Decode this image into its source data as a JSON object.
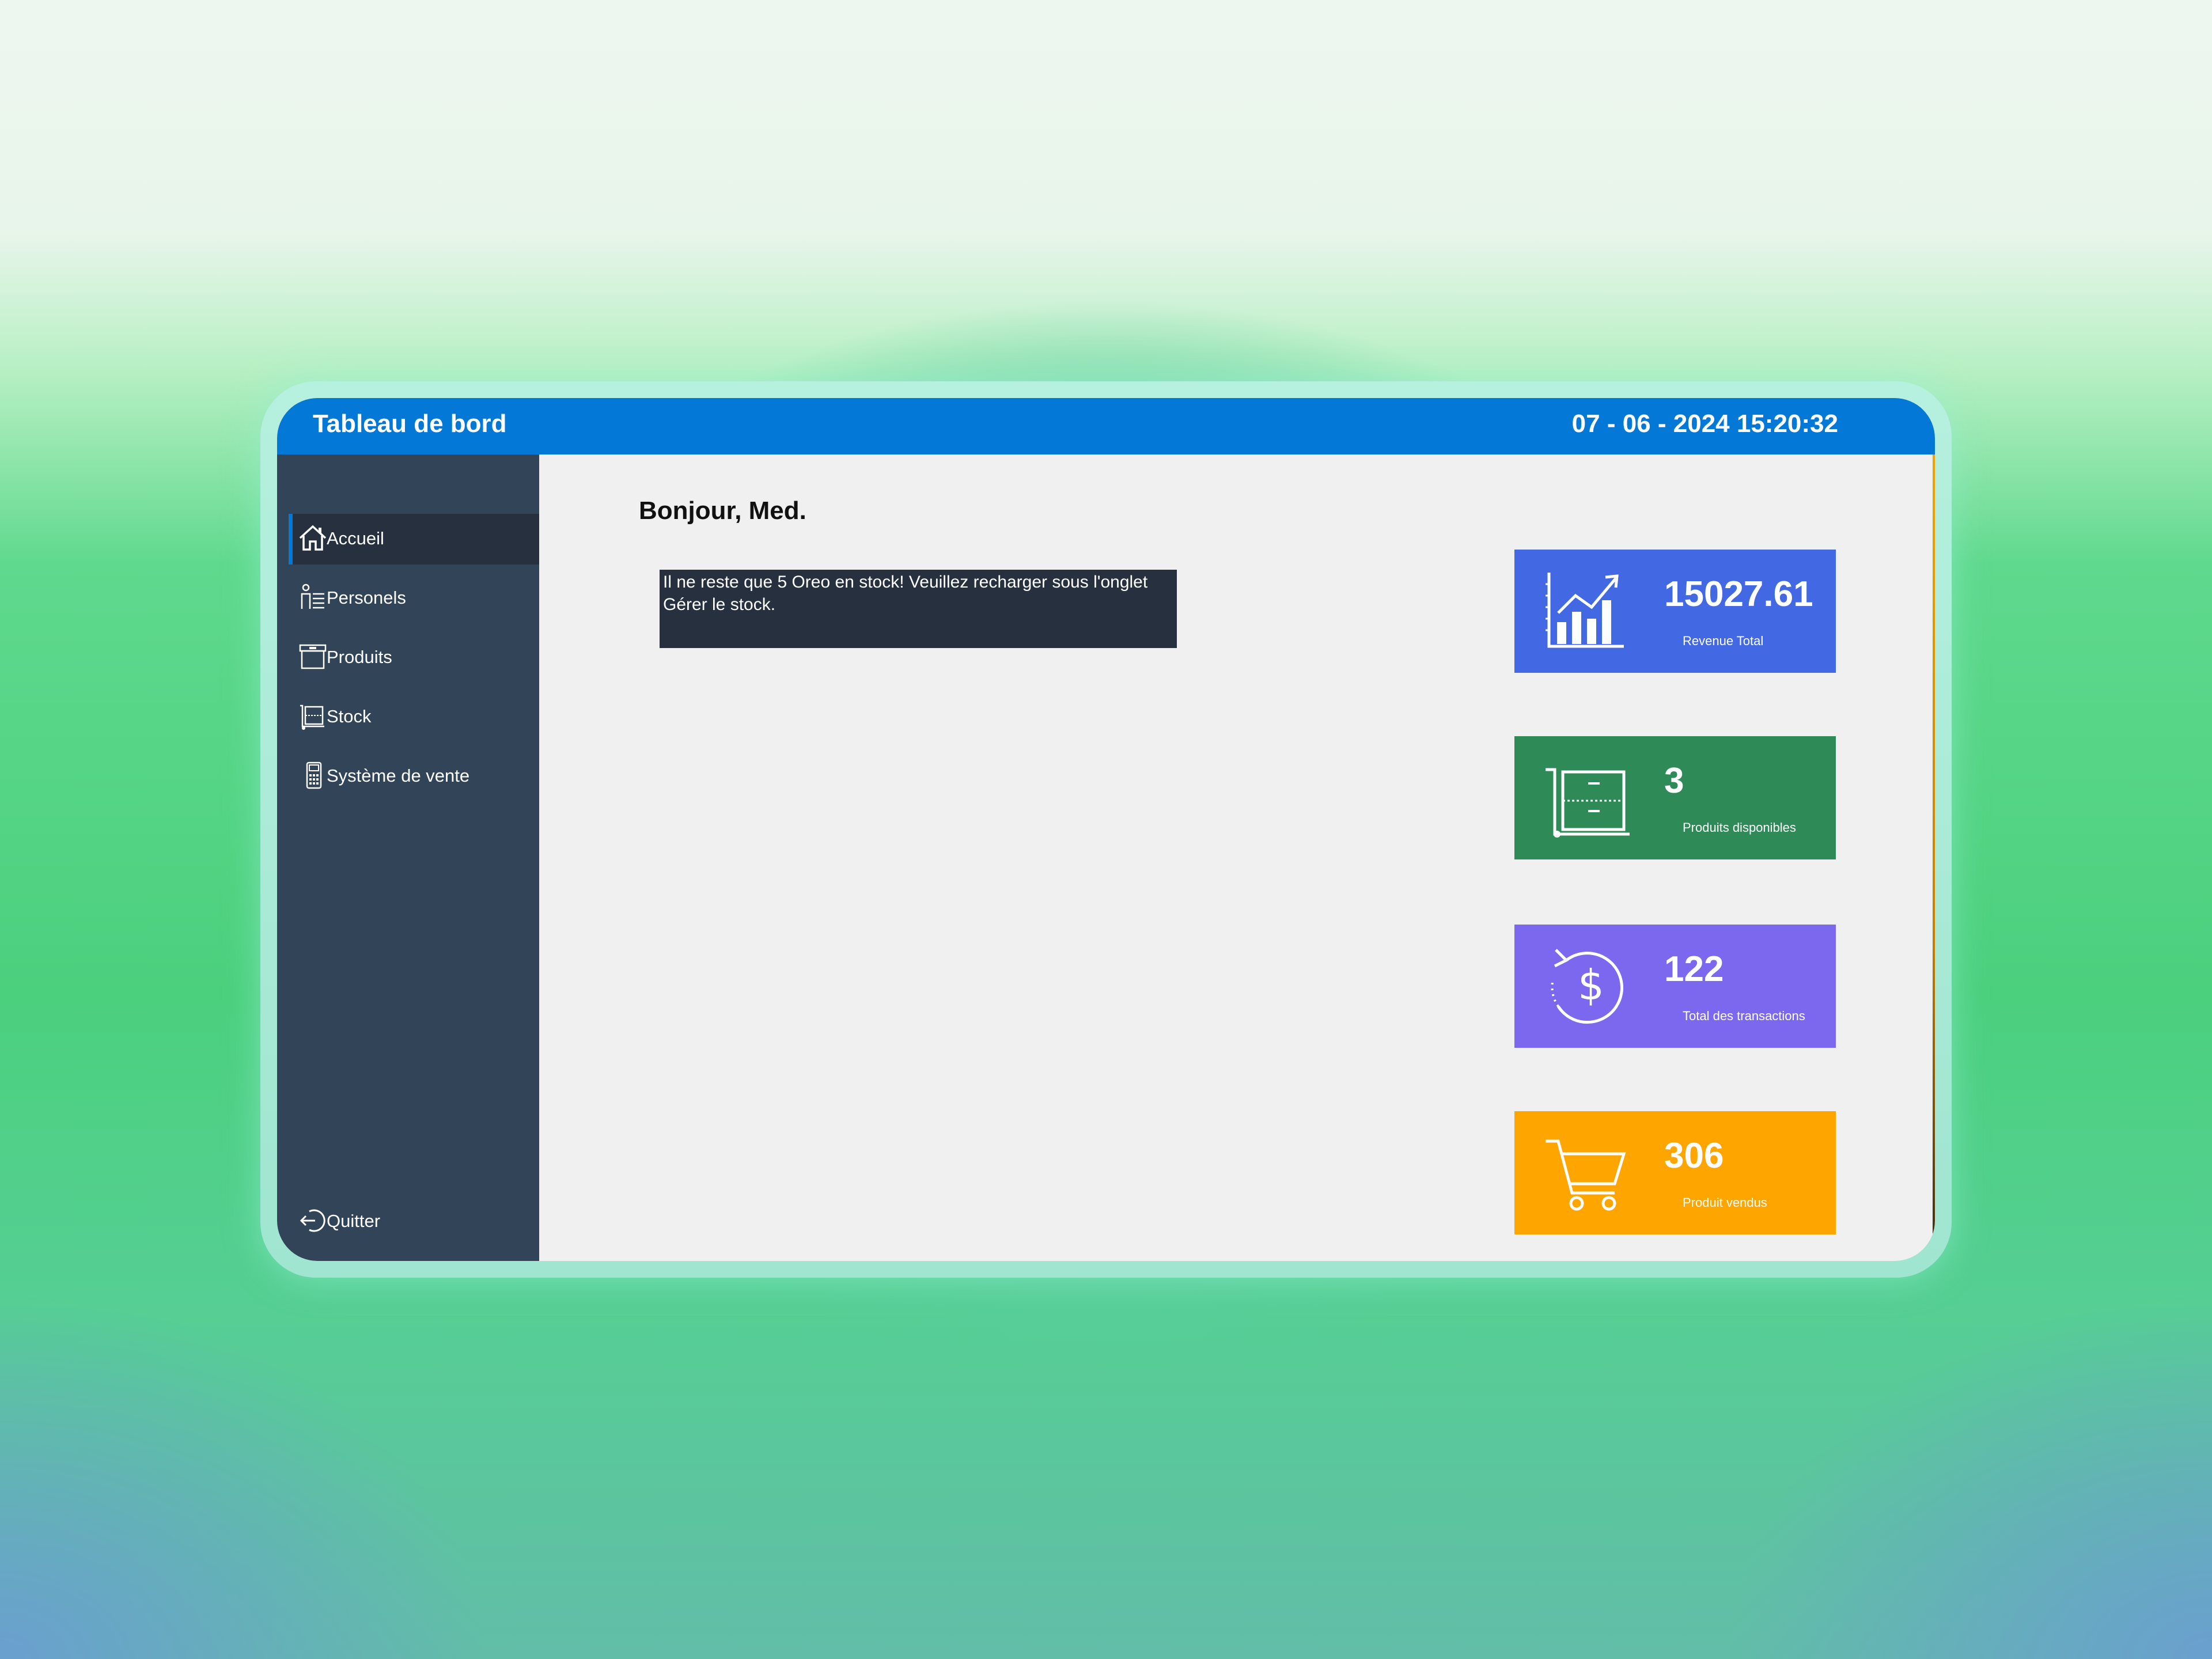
{
  "window": {
    "title": "Tableau de bord",
    "datetime": "07 - 06 - 2024 15:20:32"
  },
  "sidebar": {
    "items": [
      {
        "label": "Accueil",
        "icon": "home-icon",
        "active": true
      },
      {
        "label": "Personels",
        "icon": "personnel-list-icon"
      },
      {
        "label": "Produits",
        "icon": "box-icon"
      },
      {
        "label": "Stock",
        "icon": "stock-cart-icon"
      },
      {
        "label": "Système de vente",
        "icon": "cash-register-icon"
      }
    ],
    "quit": {
      "label": "Quitter",
      "icon": "logout-icon"
    }
  },
  "main": {
    "greeting": "Bonjour, Med.",
    "alert": "Il ne reste que 5 Oreo en stock! Veuillez recharger sous l'onglet Gérer le stock."
  },
  "cards": [
    {
      "value": "15027.61",
      "caption": "Revenue Total",
      "icon": "bar-chart-growth-icon",
      "color": "#4268e4"
    },
    {
      "value": "3",
      "caption": "Produits disponibles",
      "icon": "hand-truck-icon",
      "color": "#2e8b57"
    },
    {
      "value": "122",
      "caption": "Total des transactions",
      "icon": "dollar-refresh-icon",
      "color": "#7b68ee"
    },
    {
      "value": "306",
      "caption": "Produit vendus",
      "icon": "shopping-cart-icon",
      "color": "#ffa500"
    }
  ],
  "colors": {
    "titlebar": "#0478d6",
    "sidebar": "#324458",
    "sidebar_active": "#26303f",
    "content_bg": "#f0f0f0"
  }
}
